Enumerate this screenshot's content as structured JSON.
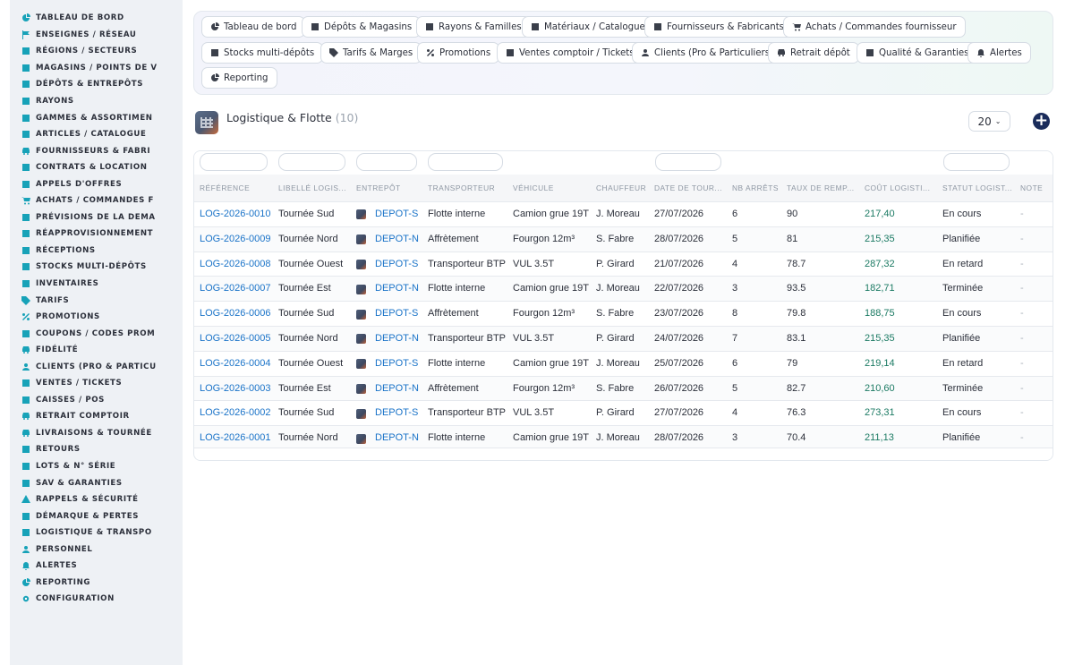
{
  "sidebar": {
    "items": [
      {
        "label": "TABLEAU DE BORD",
        "icon": "dashboard-icon"
      },
      {
        "label": "ENSEIGNES / RÉSEAU",
        "icon": "flag-icon"
      },
      {
        "label": "RÉGIONS / SECTEURS",
        "icon": "map-icon"
      },
      {
        "label": "MAGASINS / POINTS DE V",
        "icon": "store-icon"
      },
      {
        "label": "DÉPÔTS & ENTREPÔTS",
        "icon": "warehouse-icon"
      },
      {
        "label": "RAYONS",
        "icon": "shelf-icon"
      },
      {
        "label": "GAMMES & ASSORTIMEN",
        "icon": "layers-icon"
      },
      {
        "label": "ARTICLES / CATALOGUE",
        "icon": "book-icon"
      },
      {
        "label": "FOURNISSEURS & FABRI",
        "icon": "truck-icon"
      },
      {
        "label": "CONTRATS & LOCATION",
        "icon": "file-icon"
      },
      {
        "label": "APPELS D'OFFRES",
        "icon": "gavel-icon"
      },
      {
        "label": "ACHATS / COMMANDES F",
        "icon": "cart-icon"
      },
      {
        "label": "PRÉVISIONS DE LA DEMA",
        "icon": "chart-icon"
      },
      {
        "label": "RÉAPPROVISIONNEMENT",
        "icon": "refresh-icon"
      },
      {
        "label": "RÉCEPTIONS",
        "icon": "dolly-icon"
      },
      {
        "label": "STOCKS MULTI-DÉPÔTS",
        "icon": "boxes-icon"
      },
      {
        "label": "INVENTAIRES",
        "icon": "clipboard-icon"
      },
      {
        "label": "TARIFS",
        "icon": "tag-icon"
      },
      {
        "label": "PROMOTIONS",
        "icon": "percent-icon"
      },
      {
        "label": "COUPONS / CODES PROM",
        "icon": "ticket-icon"
      },
      {
        "label": "FIDÉLITÉ",
        "icon": "card-icon"
      },
      {
        "label": "CLIENTS (PRO & PARTICU",
        "icon": "user-icon"
      },
      {
        "label": "VENTES / TICKETS",
        "icon": "receipt-icon"
      },
      {
        "label": "CAISSES / POS",
        "icon": "cash-register-icon"
      },
      {
        "label": "RETRAIT COMPTOIR",
        "icon": "car-icon"
      },
      {
        "label": "LIVRAISONS & TOURNÉE",
        "icon": "delivery-truck-icon"
      },
      {
        "label": "RETOURS",
        "icon": "undo-icon"
      },
      {
        "label": "LOTS & N° SÉRIE",
        "icon": "list-icon"
      },
      {
        "label": "SAV & GARANTIES",
        "icon": "tools-icon"
      },
      {
        "label": "RAPPELS & SÉCURITÉ",
        "icon": "warning-icon"
      },
      {
        "label": "DÉMARQUE & PERTES",
        "icon": "trash-icon"
      },
      {
        "label": "LOGISTIQUE & TRANSPO",
        "icon": "route-icon"
      },
      {
        "label": "PERSONNEL",
        "icon": "users-icon"
      },
      {
        "label": "ALERTES",
        "icon": "bell-icon"
      },
      {
        "label": "REPORTING",
        "icon": "pie-icon"
      },
      {
        "label": "CONFIGURATION",
        "icon": "gear-icon"
      }
    ]
  },
  "tabs": [
    {
      "label": "Tableau de bord",
      "icon": "dashboard-icon"
    },
    {
      "label": "Dépôts & Magasins",
      "icon": "warehouse-icon"
    },
    {
      "label": "Rayons & Familles",
      "icon": "basket-icon"
    },
    {
      "label": "Matériaux / Catalogue",
      "icon": "calendar-icon"
    },
    {
      "label": "Fournisseurs & Fabricants",
      "icon": "dolly-icon"
    },
    {
      "label": "Achats / Commandes fournisseur",
      "icon": "cart-icon"
    },
    {
      "label": "Stocks multi-dépôts",
      "icon": "boxes-icon"
    },
    {
      "label": "Tarifs & Marges",
      "icon": "tags-icon"
    },
    {
      "label": "Promotions",
      "icon": "percent-icon"
    },
    {
      "label": "Ventes comptoir / Tickets",
      "icon": "receipt-icon"
    },
    {
      "label": "Clients (Pro & Particuliers)",
      "icon": "user-icon"
    },
    {
      "label": "Retrait dépôt",
      "icon": "car-icon"
    },
    {
      "label": "Qualité & Garanties",
      "icon": "check-double-icon"
    },
    {
      "label": "Alertes",
      "icon": "bell-icon"
    },
    {
      "label": "Reporting",
      "icon": "pie-icon"
    }
  ],
  "section": {
    "title": "Logistique & Flotte",
    "count": "(10)",
    "page_size": "20",
    "add_label": "+"
  },
  "table": {
    "columns": [
      "RÉFÉRENCE",
      "LIBELLÉ LOGIS...",
      "ENTREPÔT",
      "TRANSPORTEUR",
      "VÉHICULE",
      "CHAUFFEUR",
      "DATE DE TOUR...",
      "NB ARRÊTS",
      "TAUX DE REMP...",
      "COÛT LOGISTI...",
      "STATUT LOGIST...",
      "NOTE"
    ],
    "rows": [
      [
        "LOG-2026-0010",
        "Tournée Sud",
        "DEPOT-S",
        "Flotte interne",
        "Camion grue 19T",
        "J. Moreau",
        "27/07/2026",
        "6",
        "90",
        "217,40",
        "En cours",
        "-"
      ],
      [
        "LOG-2026-0009",
        "Tournée Nord",
        "DEPOT-N",
        "Affrètement",
        "Fourgon 12m³",
        "S. Fabre",
        "28/07/2026",
        "5",
        "81",
        "215,35",
        "Planifiée",
        "-"
      ],
      [
        "LOG-2026-0008",
        "Tournée Ouest",
        "DEPOT-S",
        "Transporteur BTP",
        "VUL 3.5T",
        "P. Girard",
        "21/07/2026",
        "4",
        "78.7",
        "287,32",
        "En retard",
        "-"
      ],
      [
        "LOG-2026-0007",
        "Tournée Est",
        "DEPOT-N",
        "Flotte interne",
        "Camion grue 19T",
        "J. Moreau",
        "22/07/2026",
        "3",
        "93.5",
        "182,71",
        "Terminée",
        "-"
      ],
      [
        "LOG-2026-0006",
        "Tournée Sud",
        "DEPOT-S",
        "Affrètement",
        "Fourgon 12m³",
        "S. Fabre",
        "23/07/2026",
        "8",
        "79.8",
        "188,75",
        "En cours",
        "-"
      ],
      [
        "LOG-2026-0005",
        "Tournée Nord",
        "DEPOT-N",
        "Transporteur BTP",
        "VUL 3.5T",
        "P. Girard",
        "24/07/2026",
        "7",
        "83.1",
        "215,35",
        "Planifiée",
        "-"
      ],
      [
        "LOG-2026-0004",
        "Tournée Ouest",
        "DEPOT-S",
        "Flotte interne",
        "Camion grue 19T",
        "J. Moreau",
        "25/07/2026",
        "6",
        "79",
        "219,14",
        "En retard",
        "-"
      ],
      [
        "LOG-2026-0003",
        "Tournée Est",
        "DEPOT-N",
        "Affrètement",
        "Fourgon 12m³",
        "S. Fabre",
        "26/07/2026",
        "5",
        "82.7",
        "210,60",
        "Terminée",
        "-"
      ],
      [
        "LOG-2026-0002",
        "Tournée Sud",
        "DEPOT-S",
        "Transporteur BTP",
        "VUL 3.5T",
        "P. Girard",
        "27/07/2026",
        "4",
        "76.3",
        "273,31",
        "En cours",
        "-"
      ],
      [
        "LOG-2026-0001",
        "Tournée Nord",
        "DEPOT-N",
        "Flotte interne",
        "Camion grue 19T",
        "J. Moreau",
        "28/07/2026",
        "3",
        "70.4",
        "211,13",
        "Planifiée",
        "-"
      ]
    ]
  },
  "colors": {
    "accent": "#17a2b8",
    "link": "#1a73c8",
    "cost": "#1b7a63",
    "add_button": "#1a2c5b"
  }
}
